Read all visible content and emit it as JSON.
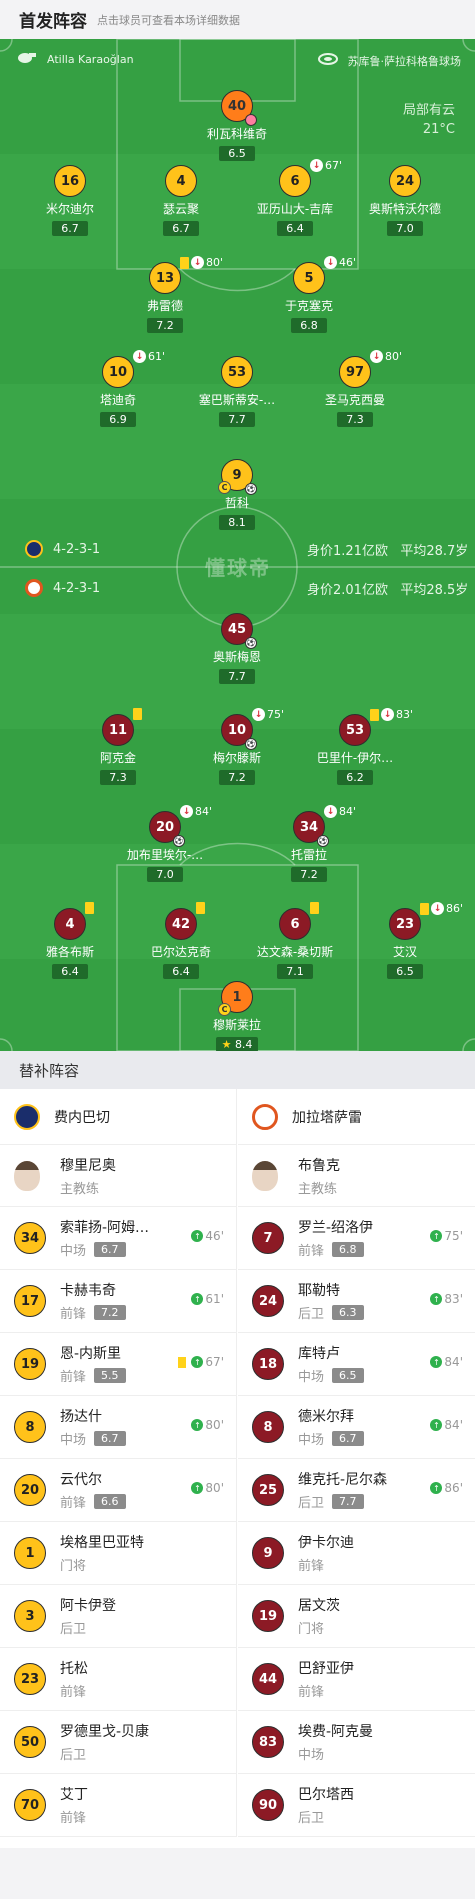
{
  "header": {
    "title": "首发阵容",
    "hint": "点击球员可查看本场详细数据"
  },
  "match": {
    "referee": "Atilla Karaoğlan",
    "stadium": "苏库鲁·萨拉科格鲁球场",
    "weather": "局部有云",
    "temperature": "21°C",
    "watermark": "懂球帝"
  },
  "home": {
    "name": "费内巴切",
    "formation": "4-2-3-1",
    "value": "身价1.21亿欧",
    "avg_age": "平均28.7岁",
    "color": "#ffc21a"
  },
  "away": {
    "name": "加拉塔萨雷",
    "formation": "4-2-3-1",
    "value": "身价2.01亿欧",
    "avg_age": "平均28.5岁",
    "color": "#8c1a25"
  },
  "home_players": [
    {
      "num": "40",
      "name": "利瓦科维奇",
      "rating": "6.5"
    },
    {
      "num": "16",
      "name": "米尔迪尔",
      "rating": "6.7"
    },
    {
      "num": "4",
      "name": "瑟云聚",
      "rating": "6.7"
    },
    {
      "num": "6",
      "name": "亚历山大-吉库",
      "rating": "6.4",
      "event": "67'"
    },
    {
      "num": "24",
      "name": "奥斯特沃尔德",
      "rating": "7.0"
    },
    {
      "num": "13",
      "name": "弗雷德",
      "rating": "7.2",
      "event": "80'"
    },
    {
      "num": "5",
      "name": "于克塞克",
      "rating": "6.8",
      "event": "46'"
    },
    {
      "num": "10",
      "name": "塔迪奇",
      "rating": "6.9",
      "event": "61'"
    },
    {
      "num": "53",
      "name": "塞巴斯蒂安-…",
      "rating": "7.7"
    },
    {
      "num": "97",
      "name": "圣马克西曼",
      "rating": "7.3",
      "event": "80'"
    },
    {
      "num": "9",
      "name": "哲科",
      "rating": "8.1"
    }
  ],
  "away_players": [
    {
      "num": "45",
      "name": "奥斯梅恩",
      "rating": "7.7"
    },
    {
      "num": "11",
      "name": "阿克金",
      "rating": "7.3"
    },
    {
      "num": "10",
      "name": "梅尔滕斯",
      "rating": "7.2",
      "event": "75'"
    },
    {
      "num": "53",
      "name": "巴里什-伊尔…",
      "rating": "6.2",
      "event": "83'"
    },
    {
      "num": "20",
      "name": "加布里埃尔-…",
      "rating": "7.0",
      "event": "84'"
    },
    {
      "num": "34",
      "name": "托雷拉",
      "rating": "7.2",
      "event": "84'"
    },
    {
      "num": "4",
      "name": "雅各布斯",
      "rating": "6.4"
    },
    {
      "num": "42",
      "name": "巴尔达克奇",
      "rating": "6.4"
    },
    {
      "num": "6",
      "name": "达文森-桑切斯",
      "rating": "7.1"
    },
    {
      "num": "23",
      "name": "艾汉",
      "rating": "6.5",
      "event": "86'"
    },
    {
      "num": "1",
      "name": "穆斯莱拉",
      "rating": "8.4"
    }
  ],
  "subs_title": "替补阵容",
  "coach_role": "主教练",
  "home_coach": "穆里尼奥",
  "away_coach": "布鲁克",
  "home_subs": [
    {
      "num": "34",
      "name": "索菲扬-阿姆…",
      "pos": "中场",
      "rating": "6.7",
      "in": "46'"
    },
    {
      "num": "17",
      "name": "卡赫韦奇",
      "pos": "前锋",
      "rating": "7.2",
      "in": "61'"
    },
    {
      "num": "19",
      "name": "恩-内斯里",
      "pos": "前锋",
      "rating": "5.5",
      "in": "67'"
    },
    {
      "num": "8",
      "name": "扬达什",
      "pos": "中场",
      "rating": "6.7",
      "in": "80'"
    },
    {
      "num": "20",
      "name": "云代尔",
      "pos": "前锋",
      "rating": "6.6",
      "in": "80'"
    },
    {
      "num": "1",
      "name": "埃格里巴亚特",
      "pos": "门将"
    },
    {
      "num": "3",
      "name": "阿卡伊登",
      "pos": "后卫"
    },
    {
      "num": "23",
      "name": "托松",
      "pos": "前锋"
    },
    {
      "num": "50",
      "name": "罗德里戈-贝康",
      "pos": "后卫"
    },
    {
      "num": "70",
      "name": "艾丁",
      "pos": "前锋"
    }
  ],
  "away_subs": [
    {
      "num": "7",
      "name": "罗兰-绍洛伊",
      "pos": "前锋",
      "rating": "6.8",
      "in": "75'"
    },
    {
      "num": "24",
      "name": "耶勒特",
      "pos": "后卫",
      "rating": "6.3",
      "in": "83'"
    },
    {
      "num": "18",
      "name": "库特卢",
      "pos": "中场",
      "rating": "6.5",
      "in": "84'"
    },
    {
      "num": "8",
      "name": "德米尔拜",
      "pos": "中场",
      "rating": "6.7",
      "in": "84'"
    },
    {
      "num": "25",
      "name": "维克托-尼尔森",
      "pos": "后卫",
      "rating": "7.7",
      "in": "86'"
    },
    {
      "num": "9",
      "name": "伊卡尔迪",
      "pos": "前锋"
    },
    {
      "num": "19",
      "name": "居文茨",
      "pos": "门将"
    },
    {
      "num": "44",
      "name": "巴舒亚伊",
      "pos": "前锋"
    },
    {
      "num": "83",
      "name": "埃费-阿克曼",
      "pos": "中场"
    },
    {
      "num": "90",
      "name": "巴尔塔西",
      "pos": "后卫"
    }
  ]
}
